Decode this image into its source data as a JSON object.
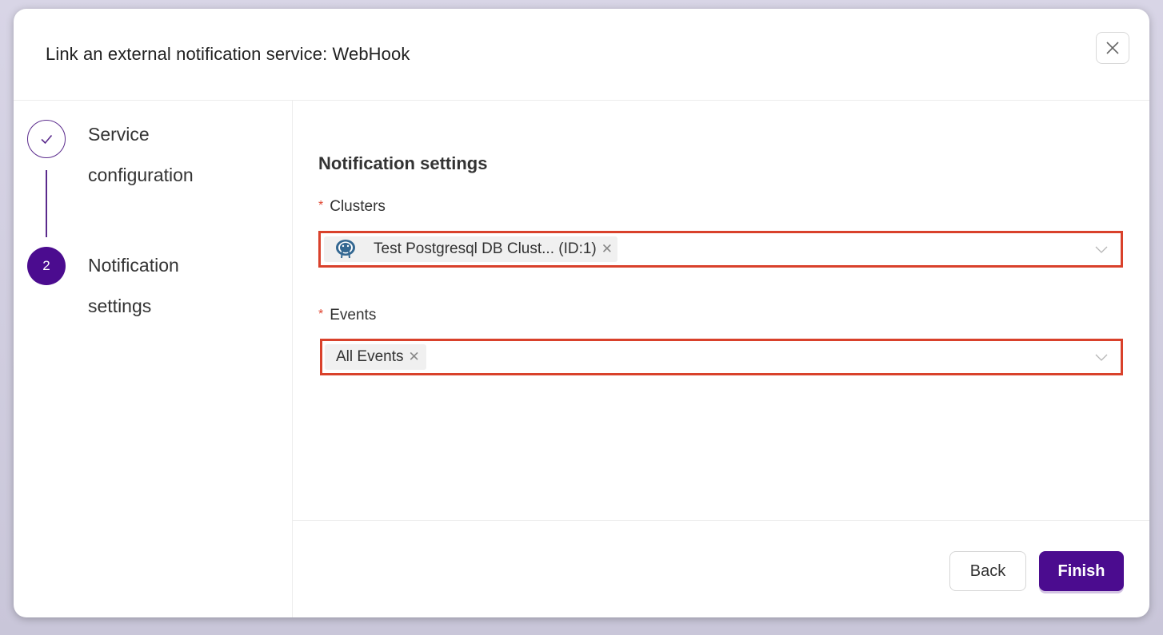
{
  "dialog": {
    "title": "Link an external notification service: WebHook"
  },
  "steps": [
    {
      "label_line1": "Service",
      "label_line2": "configuration",
      "status": "completed"
    },
    {
      "number": "2",
      "label_line1": "Notification",
      "label_line2": "settings",
      "status": "active"
    }
  ],
  "form": {
    "section_title": "Notification settings",
    "clusters": {
      "label": "Clusters",
      "required_mark": "*",
      "selected": [
        {
          "icon": "postgresql-icon",
          "text": "Test Postgresql DB Clust... (ID:1)"
        }
      ]
    },
    "events": {
      "label": "Events",
      "required_mark": "*",
      "selected": [
        {
          "text": "All Events"
        }
      ]
    }
  },
  "footer": {
    "back_label": "Back",
    "finish_label": "Finish"
  },
  "colors": {
    "primary": "#4b0c8f",
    "highlight_border": "#d9412b",
    "required": "#e0442f"
  }
}
